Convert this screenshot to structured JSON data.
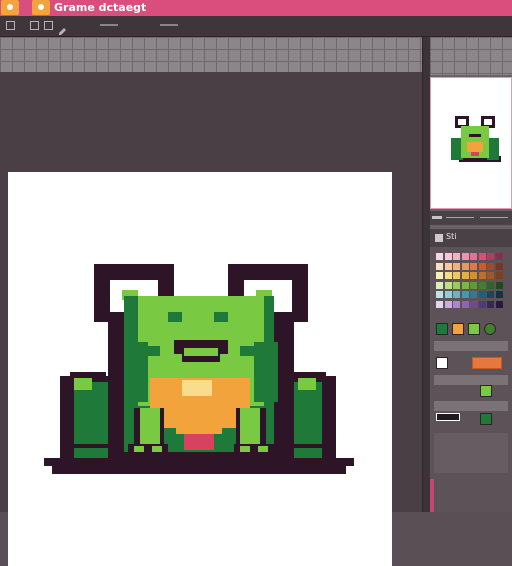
{
  "app": {
    "title": "Grame dctaegt"
  },
  "colors": {
    "titlebar": "#d94e7d",
    "accent": "#f3a33b",
    "frog_dark": "#2d1426",
    "frog_green": "#7ac943",
    "frog_green_dark": "#1f7a3a",
    "frog_belly": "#f3a33b",
    "frog_belly_light": "#f9dc8c",
    "frog_leg_red": "#d9425e"
  },
  "palette": {
    "title": "Sti",
    "swatches": [
      "#f6d6e4",
      "#f4c6d6",
      "#f1b2c6",
      "#ec93b1",
      "#e56f98",
      "#d94e7d",
      "#b63a66",
      "#8c2c52",
      "#f7e0c2",
      "#f4c9a0",
      "#f1b27d",
      "#ec975c",
      "#e6773f",
      "#cf5a2e",
      "#a8472a",
      "#7a3424",
      "#f9f0b8",
      "#f4de85",
      "#f0c95e",
      "#e9ae3b",
      "#d98f2a",
      "#c06f28",
      "#a45623",
      "#7c3f1f",
      "#d9f0b4",
      "#b9e08a",
      "#96cd63",
      "#78b845",
      "#5c9c36",
      "#43802d",
      "#2f6526",
      "#1f4a1f",
      "#bde3e8",
      "#8fcfd9",
      "#62b7c7",
      "#3e9bb2",
      "#2b7c96",
      "#205f78",
      "#19475d",
      "#123244",
      "#e4d4ec",
      "#c9aedb",
      "#a988c7",
      "#8a67b0",
      "#6c4c94",
      "#523875",
      "#3b2757",
      "#27193b"
    ]
  }
}
